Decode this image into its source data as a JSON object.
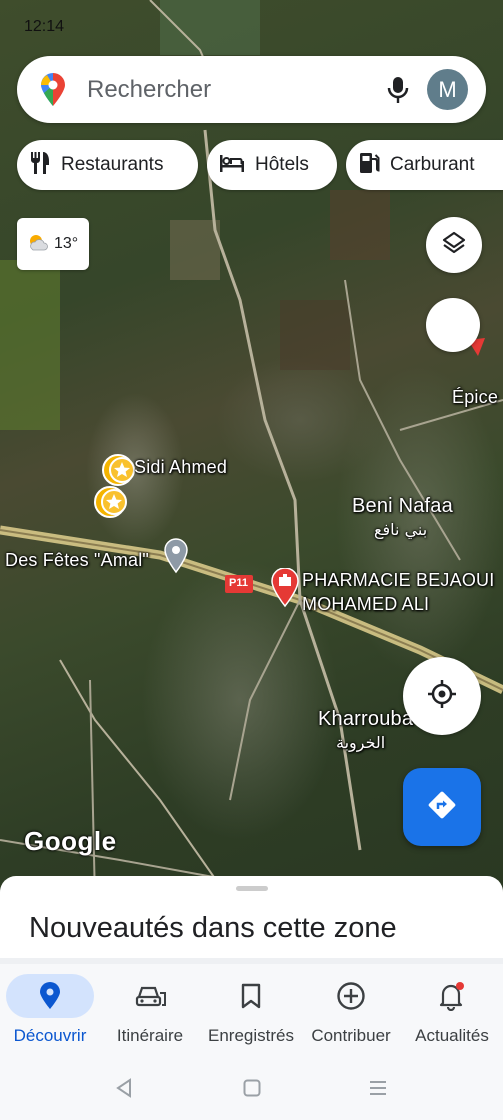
{
  "status_bar": {
    "time": "12:14"
  },
  "search": {
    "placeholder": "Rechercher",
    "avatar_letter": "M"
  },
  "chips": [
    {
      "label": "Restaurants",
      "icon": "fork-knife-icon"
    },
    {
      "label": "Hôtels",
      "icon": "bed-icon"
    },
    {
      "label": "Carburant",
      "icon": "fuel-pump-icon"
    }
  ],
  "weather": {
    "temperature": "13°",
    "icon": "partly-cloudy-icon"
  },
  "map_labels": {
    "sidi_ahmed": "Sidi Ahmed",
    "beni_nafaa": "Beni Nafaa",
    "beni_nafaa_ar": "بني نافع",
    "des_fetes": "Des Fêtes \"Amal\"",
    "pharmacie_line1": "PHARMACIE BEJAOUI",
    "pharmacie_line2": "MOHAMED ALI",
    "kharrouba": "Kharrouba",
    "kharrouba_ar": "الخروبة",
    "epice": "Épice",
    "road_p11": "P11"
  },
  "google_logo": "Google",
  "sheet": {
    "title": "Nouveautés dans cette zone"
  },
  "nav": [
    {
      "label": "Découvrir",
      "icon": "location-pin-icon",
      "active": true
    },
    {
      "label": "Itinéraire",
      "icon": "car-icon",
      "active": false
    },
    {
      "label": "Enregistrés",
      "icon": "bookmark-icon",
      "active": false
    },
    {
      "label": "Contribuer",
      "icon": "add-circle-icon",
      "active": false
    },
    {
      "label": "Actualités",
      "icon": "bell-icon",
      "active": false
    }
  ],
  "colors": {
    "accent": "#1a73e8",
    "active_nav_bg": "#d3e3fd",
    "pharmacy_red": "#e53935",
    "road_yellow": "#d8c98a"
  }
}
